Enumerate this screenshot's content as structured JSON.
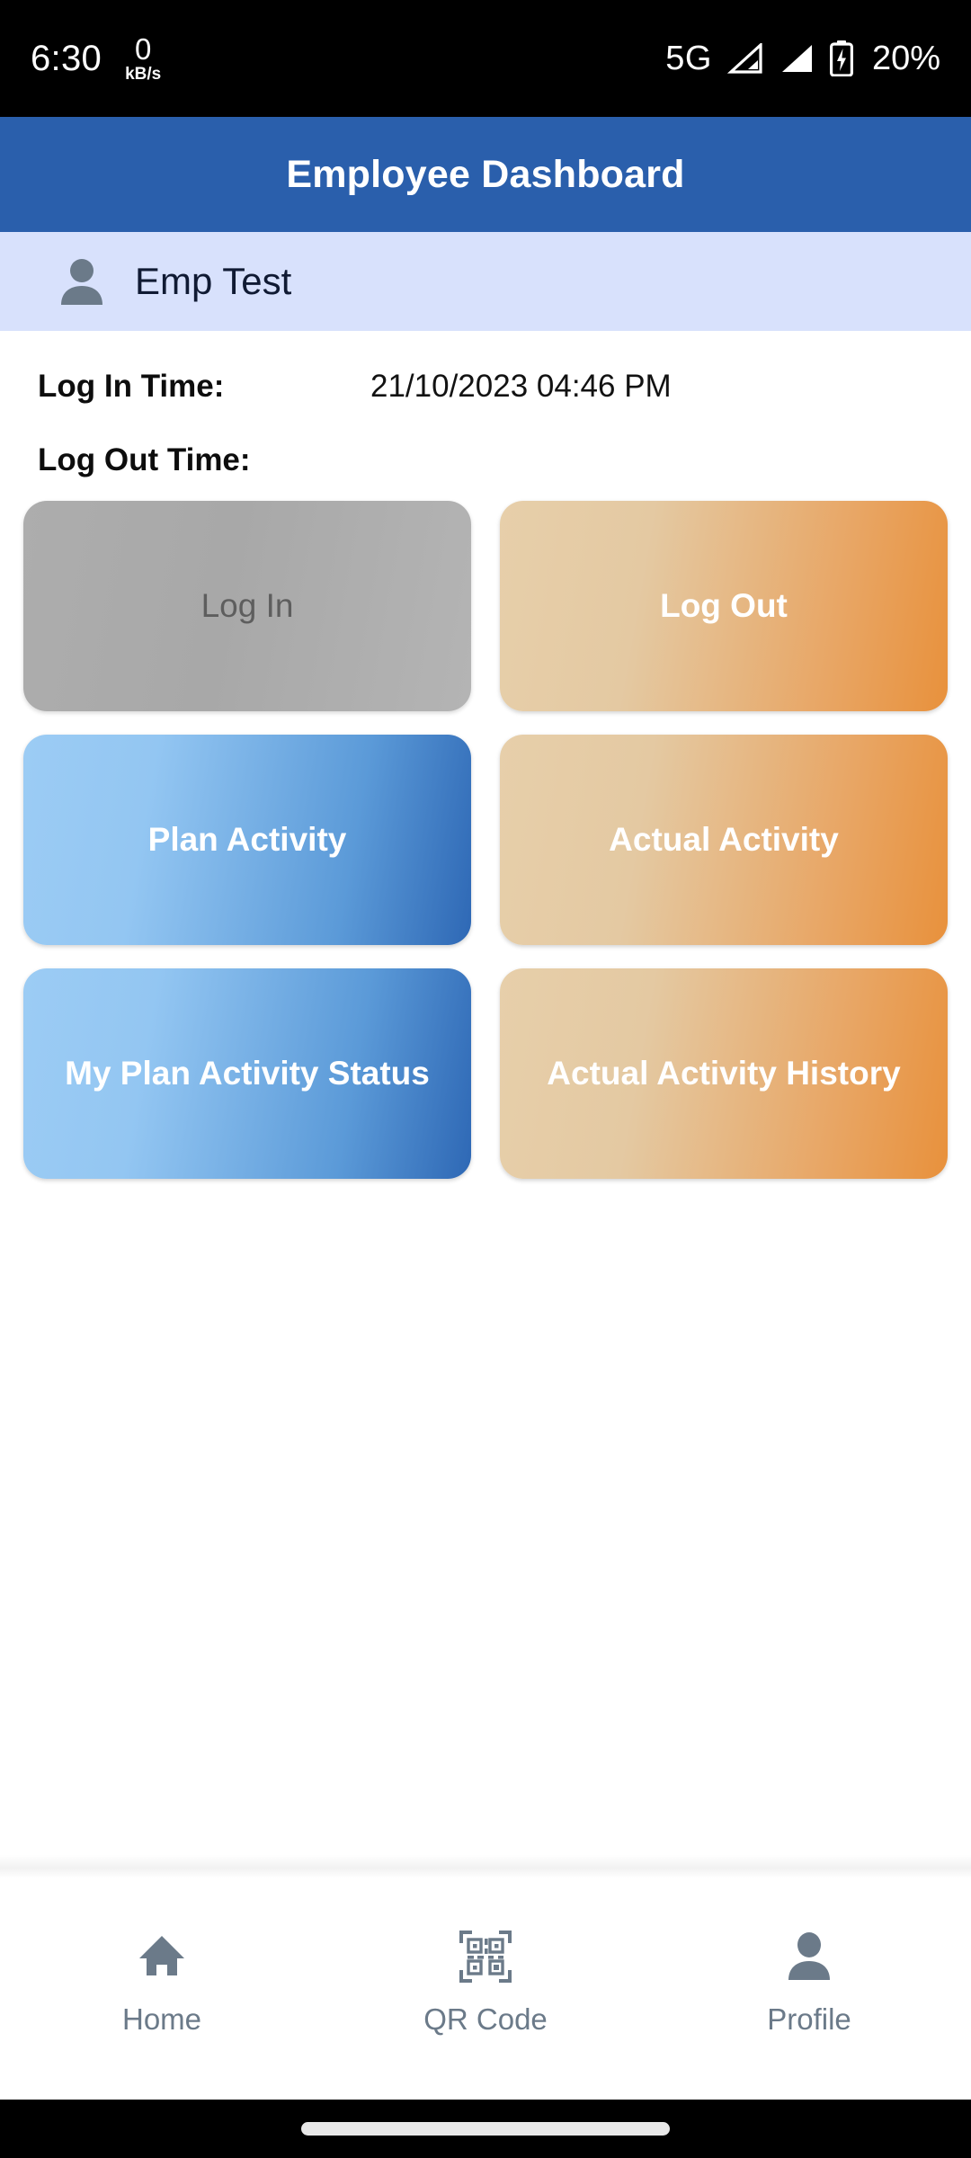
{
  "status_bar": {
    "clock": "6:30",
    "net_speed_value": "0",
    "net_speed_unit": "kB/s",
    "network_type": "5G",
    "signal_icon_1": "signal-bar-partial-icon",
    "signal_icon_2": "signal-bar-full-icon",
    "battery_icon": "battery-charging-icon",
    "battery_percent": "20%"
  },
  "app_bar": {
    "title": "Employee Dashboard",
    "background_color": "#2A5FAC",
    "title_color": "#FFFFFF"
  },
  "user_band": {
    "avatar_icon": "person-icon",
    "name": "Emp Test",
    "background_color": "#D8E1FC",
    "name_color": "#101A33"
  },
  "info": {
    "login_label": "Log In Time:",
    "login_value": "21/10/2023 04:46 PM",
    "logout_label": "Log Out Time:",
    "logout_value": ""
  },
  "tiles": [
    {
      "label": "Log In",
      "style": "disabled",
      "enabled": false,
      "color": "#ADADAD"
    },
    {
      "label": "Log Out",
      "style": "orange",
      "enabled": true,
      "color": "#E8913C"
    },
    {
      "label": "Plan Activity",
      "style": "blue",
      "enabled": true,
      "color": "#2E68B5"
    },
    {
      "label": "Actual Activity",
      "style": "orange",
      "enabled": true,
      "color": "#E8913C"
    },
    {
      "label": "My Plan Activity Status",
      "style": "blue",
      "enabled": true,
      "color": "#2E68B5"
    },
    {
      "label": "Actual Activity History",
      "style": "orange",
      "enabled": true,
      "color": "#E8913C"
    }
  ],
  "bottom_nav": {
    "items": [
      {
        "label": "Home",
        "icon": "home-icon",
        "selected": false
      },
      {
        "label": "QR Code",
        "icon": "qr-code-icon",
        "selected": false
      },
      {
        "label": "Profile",
        "icon": "person-icon",
        "selected": false
      }
    ],
    "icon_color": "#6B7A89",
    "label_color": "#6B7A89"
  },
  "gesture_bar": {
    "handle_color": "#E8E8E8",
    "background_color": "#000000"
  }
}
